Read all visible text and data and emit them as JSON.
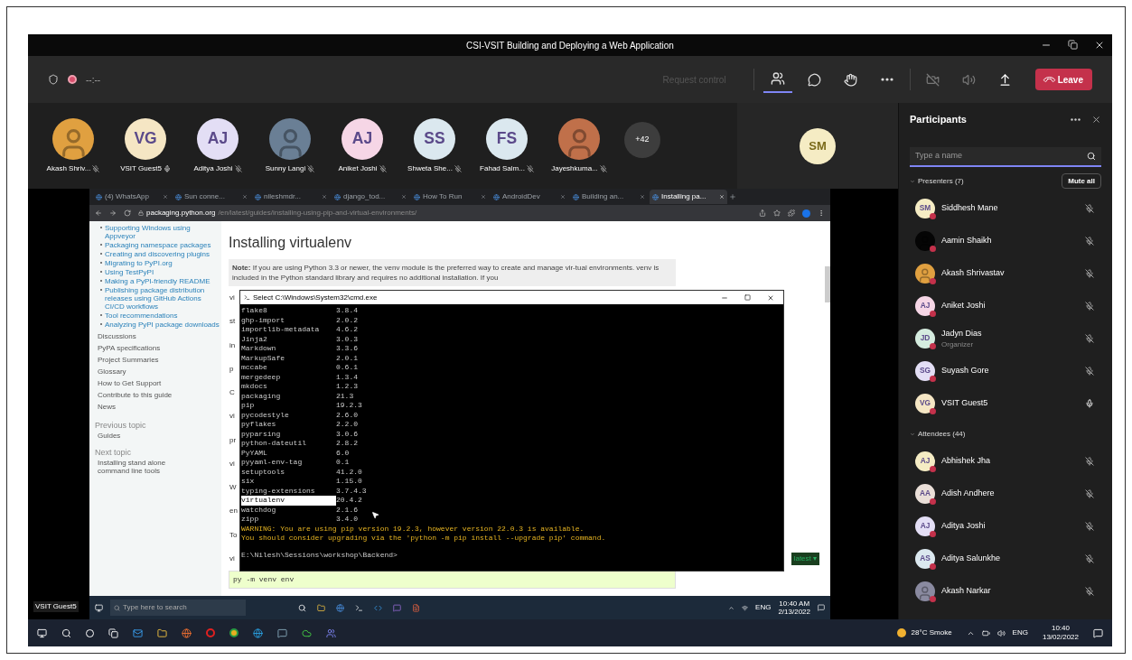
{
  "window": {
    "title": "CSI-VSIT Building and Deploying a Web Application"
  },
  "toolbar": {
    "timer": "--:--",
    "request_control": "Request control",
    "leave": "Leave",
    "people_selected": true
  },
  "gallery": [
    {
      "name": "Akash Shriv...",
      "kind": "photo",
      "color": "#e0a040",
      "muted": true
    },
    {
      "name": "VSIT Guest5",
      "kind": "initials",
      "initials": "VG",
      "color": "#f5e6c4",
      "muted": false
    },
    {
      "name": "Aditya Joshi",
      "kind": "initials",
      "initials": "AJ",
      "color": "#e3def5",
      "muted": true
    },
    {
      "name": "Sunny Langi",
      "kind": "photo",
      "color": "#6a7f95",
      "muted": true
    },
    {
      "name": "Aniket Joshi",
      "kind": "initials",
      "initials": "AJ",
      "color": "#f6d6e6",
      "muted": true
    },
    {
      "name": "Shweta She...",
      "kind": "initials",
      "initials": "SS",
      "color": "#dbe8ef",
      "muted": true
    },
    {
      "name": "Fahad Salm...",
      "kind": "initials",
      "initials": "FS",
      "color": "#dbe8ef",
      "muted": true
    },
    {
      "name": "Jayeshkuma...",
      "kind": "photo",
      "color": "#c0704a",
      "muted": true
    }
  ],
  "overflow_count": "+42",
  "speaker_tile": {
    "initials": "SM"
  },
  "share": {
    "presenter_label": "VSIT Guest5",
    "tabs": [
      {
        "title": "(4) WhatsApp",
        "selected": false
      },
      {
        "title": "Sun conne...",
        "selected": false
      },
      {
        "title": "nileshmdr...",
        "selected": false
      },
      {
        "title": "django_tod...",
        "selected": false
      },
      {
        "title": "How To Run",
        "selected": false
      },
      {
        "title": "AndroidDev",
        "selected": false
      },
      {
        "title": "Building an...",
        "selected": false
      },
      {
        "title": "Installing pa...",
        "selected": true
      }
    ],
    "url_host": "packaging.python.org",
    "url_path": "/en/latest/guides/installing-using-pip-and-virtual-environments/",
    "sidebar_links": [
      "Supporting Windows using Appveyor",
      "Packaging namespace packages",
      "Creating and discovering plugins",
      "Migrating to PyPI.org",
      "Using TestPyPI",
      "Making a PyPI-friendly README",
      "Publishing package distribution releases using GitHub Actions CI/CD workflows",
      "Tool recommendations",
      "Analyzing PyPI package downloads"
    ],
    "sidebar_sections": [
      "Discussions",
      "PyPA specifications",
      "Project Summaries",
      "Glossary",
      "How to Get Support",
      "Contribute to this guide",
      "News"
    ],
    "previous_title": "Previous topic",
    "previous_link": "Guides",
    "next_title": "Next topic",
    "next_link": "Installing stand alone command line tools",
    "heading": "Installing virtualenv",
    "note": "**Note:** If you are using Python 3.3 or newer, the venv module is the preferred way to create and manage vir-tual environments. venv is included in the Python standard library and requires no additional installation. If you",
    "fragments": [
      "vi",
      "st",
      "in",
      "p",
      "C",
      "vi",
      "pr",
      "vi",
      "W",
      "en",
      "To",
      "vi"
    ],
    "code": "py -m venv env",
    "version_badge": "latest ▾",
    "cmd": {
      "title": "Select C:\\Windows\\System32\\cmd.exe",
      "packages": [
        {
          "name": "flake8",
          "version": "3.8.4",
          "selected": false
        },
        {
          "name": "ghp-import",
          "version": "2.0.2",
          "selected": false
        },
        {
          "name": "importlib-metadata",
          "version": "4.6.2",
          "selected": false
        },
        {
          "name": "Jinja2",
          "version": "3.0.3",
          "selected": false
        },
        {
          "name": "Markdown",
          "version": "3.3.6",
          "selected": false
        },
        {
          "name": "MarkupSafe",
          "version": "2.0.1",
          "selected": false
        },
        {
          "name": "mccabe",
          "version": "0.6.1",
          "selected": false
        },
        {
          "name": "mergedeep",
          "version": "1.3.4",
          "selected": false
        },
        {
          "name": "mkdocs",
          "version": "1.2.3",
          "selected": false
        },
        {
          "name": "packaging",
          "version": "21.3",
          "selected": false
        },
        {
          "name": "pip",
          "version": "19.2.3",
          "selected": false
        },
        {
          "name": "pycodestyle",
          "version": "2.6.0",
          "selected": false
        },
        {
          "name": "pyflakes",
          "version": "2.2.0",
          "selected": false
        },
        {
          "name": "pyparsing",
          "version": "3.0.6",
          "selected": false
        },
        {
          "name": "python-dateutil",
          "version": "2.8.2",
          "selected": false
        },
        {
          "name": "PyYAML",
          "version": "6.0",
          "selected": false
        },
        {
          "name": "pyyaml-env-tag",
          "version": "0.1",
          "selected": false
        },
        {
          "name": "setuptools",
          "version": "41.2.0",
          "selected": false
        },
        {
          "name": "six",
          "version": "1.15.0",
          "selected": false
        },
        {
          "name": "typing-extensions",
          "version": "3.7.4.3",
          "selected": false
        },
        {
          "name": "virtualenv",
          "version": "20.4.2",
          "selected": true
        },
        {
          "name": "watchdog",
          "version": "2.1.6",
          "selected": false
        },
        {
          "name": "zipp",
          "version": "3.4.0",
          "selected": false
        }
      ],
      "warnings": [
        "WARNING: You are using pip version 19.2.3, however version 22.0.3 is available.",
        "You should consider upgrading via the 'python -m pip install --upgrade pip' command."
      ],
      "prompt": "E:\\Nilesh\\Sessions\\workshop\\Backend>"
    },
    "remote_taskbar": {
      "search_placeholder": "Type here to search",
      "lang": "ENG",
      "time": "10:40 AM",
      "date": "2/13/2022"
    }
  },
  "participants": {
    "title": "Participants",
    "search_placeholder": "Type a name",
    "mute_all": "Mute all",
    "groups": [
      {
        "title": "Presenters (7)",
        "expanded": true,
        "people": [
          {
            "name": "Siddhesh Mane",
            "kind": "initials",
            "initials": "SM",
            "color": "#f5ecc4",
            "muted": true
          },
          {
            "name": "Aamin Shaikh",
            "kind": "photo",
            "color": "#050505",
            "muted": true
          },
          {
            "name": "Akash Shrivastav",
            "kind": "photo",
            "color": "#e0a040",
            "muted": true
          },
          {
            "name": "Aniket Joshi",
            "kind": "initials",
            "initials": "AJ",
            "color": "#f6d6e6",
            "muted": true
          },
          {
            "name": "Jadyn Dias",
            "role": "Organizer",
            "kind": "initials",
            "initials": "JD",
            "color": "#d5ecdf",
            "muted": true
          },
          {
            "name": "Suyash Gore",
            "kind": "initials",
            "initials": "SG",
            "color": "#e3def5",
            "muted": true
          },
          {
            "name": "VSIT Guest5",
            "kind": "initials",
            "initials": "VG",
            "color": "#f5e6c4",
            "muted": false
          }
        ]
      },
      {
        "title": "Attendees (44)",
        "expanded": true,
        "people": [
          {
            "name": "Abhishek Jha",
            "kind": "initials",
            "initials": "AJ",
            "color": "#f5ecc4",
            "muted": true
          },
          {
            "name": "Adish Andhere",
            "kind": "initials",
            "initials": "AA",
            "color": "#eadfd8",
            "muted": true
          },
          {
            "name": "Aditya Joshi",
            "kind": "initials",
            "initials": "AJ",
            "color": "#e3def5",
            "muted": true
          },
          {
            "name": "Aditya Salunkhe",
            "kind": "initials",
            "initials": "AS",
            "color": "#dbe8ef",
            "muted": true
          },
          {
            "name": "Akash Narkar",
            "kind": "photo",
            "color": "#8a8aa0",
            "muted": true
          }
        ]
      }
    ]
  },
  "taskbar": {
    "weather": "28°C Smoke",
    "lang": "ENG",
    "time": "10:40",
    "date": "13/02/2022"
  }
}
